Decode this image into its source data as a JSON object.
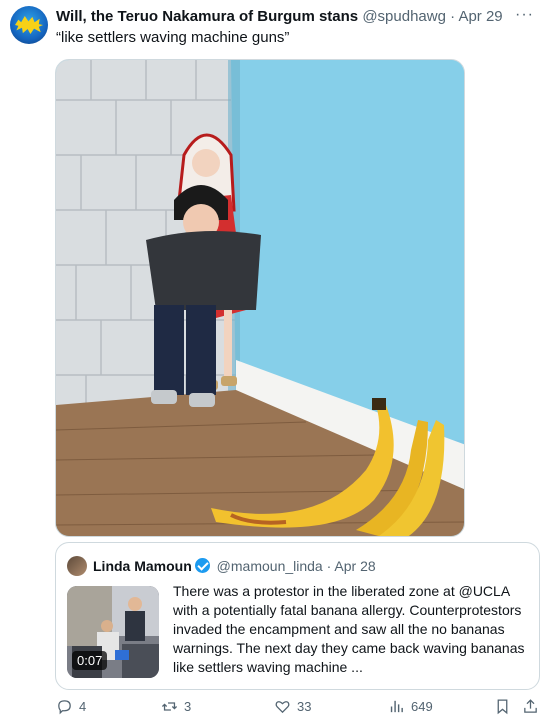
{
  "tweet": {
    "author_name": "Will, the Teruo Nakamura of Burgum stans",
    "handle": "@spudhawg",
    "separator": "·",
    "date": "Apr 29",
    "text": "“like settlers waving machine guns”",
    "more_label": "···"
  },
  "quote": {
    "author_name": "Linda Mamoun",
    "handle": "@mamoun_linda",
    "separator": "·",
    "date": "Apr 28",
    "text": "There was a protestor in the liberated zone at @UCLA with a potentially fatal banana allergy. Counterprotestors invaded the encampment and saw all the no bananas warnings. The next day they came back waving bananas like settlers waving machine ...",
    "video_duration": "0:07"
  },
  "actions": {
    "replies": "4",
    "retweets": "3",
    "likes": "33",
    "views": "649"
  },
  "colors": {
    "text_primary": "#0f1419",
    "text_secondary": "#536471",
    "border": "#cfd9de",
    "verified": "#1d9bf0"
  }
}
